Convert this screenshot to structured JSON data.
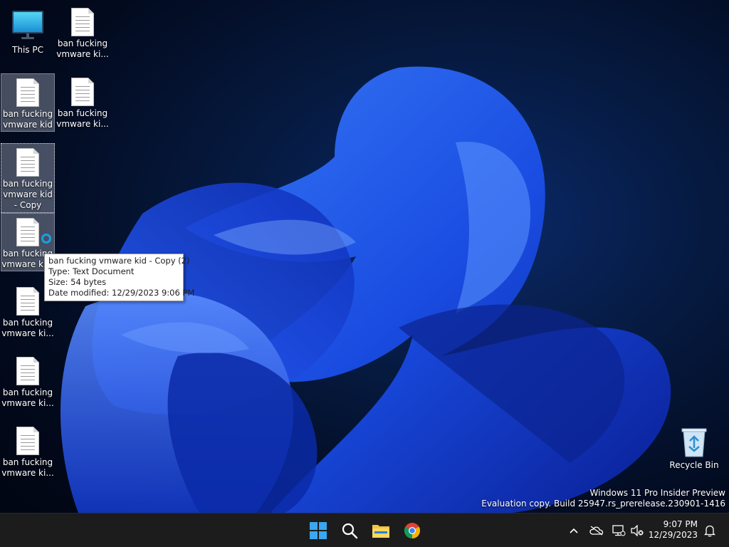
{
  "desktop": {
    "icons": [
      {
        "label": "This PC"
      },
      {
        "label": "ban fucking vmware ki..."
      },
      {
        "label": "ban fucking vmware kid"
      },
      {
        "label": "ban fucking vmware ki..."
      },
      {
        "label": "ban fucking vmware kid - Copy"
      },
      {
        "label": "ban fucking vmware ki..."
      },
      {
        "label": "ban fucking vmware ki..."
      },
      {
        "label": "ban fucking vmware ki..."
      },
      {
        "label": "ban fucking vmware ki..."
      },
      {
        "label": "Recycle Bin"
      }
    ]
  },
  "tooltip": {
    "name": "ban fucking vmware kid - Copy (2)",
    "type": "Type: Text Document",
    "size": "Size: 54 bytes",
    "modified": "Date modified: 12/29/2023 9:06 PM"
  },
  "watermark": {
    "line1": "Windows 11 Pro Insider Preview",
    "line2": "Evaluation copy. Build 25947.rs_prerelease.230901-1416"
  },
  "taskbar": {
    "time": "9:07 PM",
    "date": "12/29/2023"
  },
  "colors": {
    "accent": "#1aa0e0",
    "taskbar": "#1c1c1c"
  }
}
